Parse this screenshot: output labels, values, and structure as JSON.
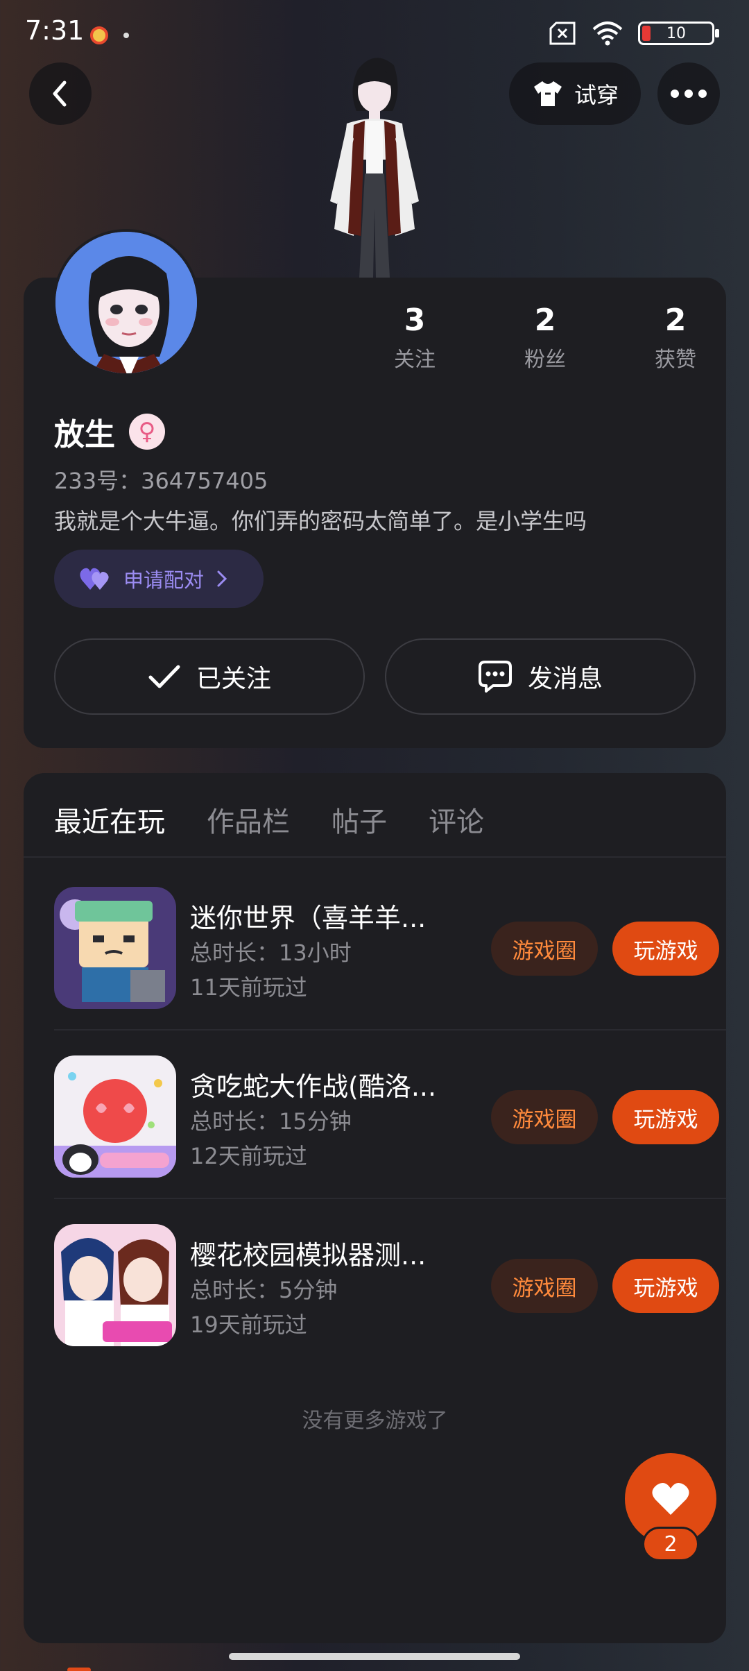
{
  "status": {
    "time": "7:31",
    "battery": "10"
  },
  "header": {
    "tryon_label": "试穿"
  },
  "profile": {
    "name": "放生",
    "uid": "233号：364757405",
    "bio": "我就是个大牛逼。你们弄的密码太简单了。是小学生吗",
    "match_label": "申请配对",
    "stats": [
      {
        "value": "3",
        "label": "关注"
      },
      {
        "value": "2",
        "label": "粉丝"
      },
      {
        "value": "2",
        "label": "获赞"
      }
    ],
    "follow_label": "已关注",
    "message_label": "发消息"
  },
  "tabs": [
    "最近在玩",
    "作品栏",
    "帖子",
    "评论"
  ],
  "games": [
    {
      "title": "迷你世界（喜羊羊...",
      "duration": "总时长：13小时",
      "played": "11天前玩过",
      "circle_label": "游戏圈",
      "play_label": "玩游戏"
    },
    {
      "title": "贪吃蛇大作战(酷洛...",
      "duration": "总时长：15分钟",
      "played": "12天前玩过",
      "circle_label": "游戏圈",
      "play_label": "玩游戏"
    },
    {
      "title": "樱花校园模拟器测...",
      "duration": "总时长：5分钟",
      "played": "19天前玩过",
      "circle_label": "游戏圈",
      "play_label": "玩游戏"
    }
  ],
  "no_more": "没有更多游戏了",
  "likes": "2",
  "colors": {
    "accent": "#e04a12",
    "match": "#9b8cf2",
    "card": "#1e1e22"
  }
}
